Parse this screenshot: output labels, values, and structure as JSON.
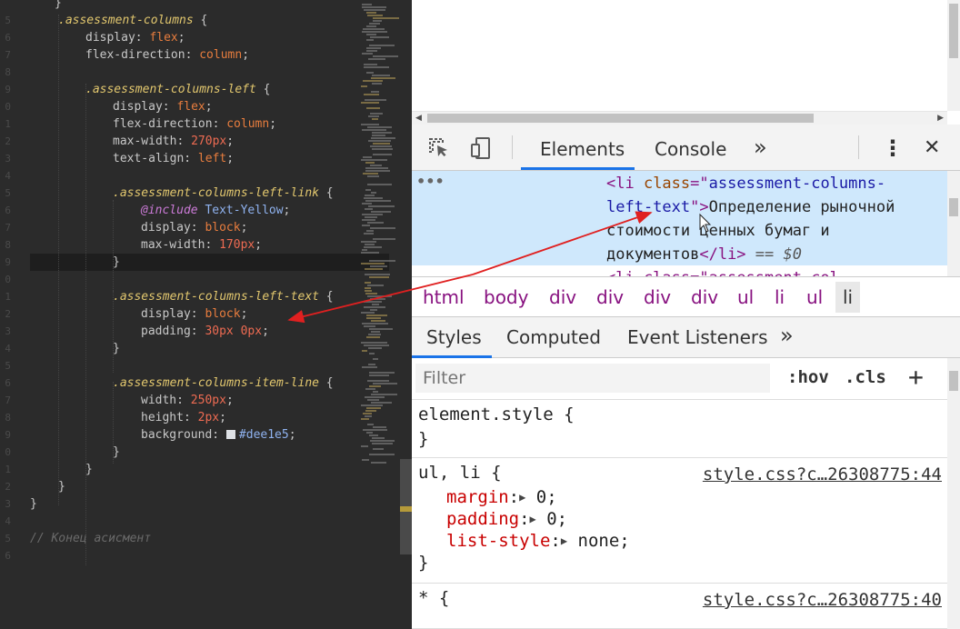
{
  "editor": {
    "lines": [
      {
        "n": "",
        "tokens": [
          {
            "c": "t-prop",
            "t": "}"
          }
        ],
        "indent": 60
      },
      {
        "n": "5",
        "tokens": [
          {
            "c": "t-sel",
            "t": ".assessment-columns"
          },
          {
            "c": "t-prop",
            "t": " {"
          }
        ],
        "indent": 64
      },
      {
        "n": "6",
        "tokens": [
          {
            "c": "t-prop",
            "t": "display: "
          },
          {
            "c": "t-kw",
            "t": "flex"
          },
          {
            "c": "t-prop",
            "t": ";"
          }
        ],
        "indent": 94
      },
      {
        "n": "7",
        "tokens": [
          {
            "c": "t-prop",
            "t": "flex-direction: "
          },
          {
            "c": "t-kw",
            "t": "column"
          },
          {
            "c": "t-prop",
            "t": ";"
          }
        ],
        "indent": 94
      },
      {
        "n": "8",
        "tokens": [],
        "indent": 94
      },
      {
        "n": "9",
        "tokens": [
          {
            "c": "t-sel",
            "t": ".assessment-columns-left"
          },
          {
            "c": "t-prop",
            "t": " {"
          }
        ],
        "indent": 94
      },
      {
        "n": "0",
        "tokens": [
          {
            "c": "t-prop",
            "t": "display: "
          },
          {
            "c": "t-kw",
            "t": "flex"
          },
          {
            "c": "t-prop",
            "t": ";"
          }
        ],
        "indent": 124
      },
      {
        "n": "1",
        "tokens": [
          {
            "c": "t-prop",
            "t": "flex-direction: "
          },
          {
            "c": "t-kw",
            "t": "column"
          },
          {
            "c": "t-prop",
            "t": ";"
          }
        ],
        "indent": 124
      },
      {
        "n": "2",
        "tokens": [
          {
            "c": "t-prop",
            "t": "max-width: "
          },
          {
            "c": "t-num",
            "t": "270px"
          },
          {
            "c": "t-prop",
            "t": ";"
          }
        ],
        "indent": 124
      },
      {
        "n": "3",
        "tokens": [
          {
            "c": "t-prop",
            "t": "text-align: "
          },
          {
            "c": "t-kw",
            "t": "left"
          },
          {
            "c": "t-prop",
            "t": ";"
          }
        ],
        "indent": 124
      },
      {
        "n": "4",
        "tokens": [],
        "indent": 124
      },
      {
        "n": "5",
        "tokens": [
          {
            "c": "t-sel",
            "t": ".assessment-columns-left-link"
          },
          {
            "c": "t-prop",
            "t": " {"
          }
        ],
        "indent": 124
      },
      {
        "n": "6",
        "tokens": [
          {
            "c": "t-at",
            "t": "@include"
          },
          {
            "c": "t-func",
            "t": " Text-Yellow"
          },
          {
            "c": "t-prop",
            "t": ";"
          }
        ],
        "indent": 155
      },
      {
        "n": "7",
        "tokens": [
          {
            "c": "t-prop",
            "t": "display: "
          },
          {
            "c": "t-kw",
            "t": "block"
          },
          {
            "c": "t-prop",
            "t": ";"
          }
        ],
        "indent": 155
      },
      {
        "n": "8",
        "tokens": [
          {
            "c": "t-prop",
            "t": "max-width: "
          },
          {
            "c": "t-num",
            "t": "170px"
          },
          {
            "c": "t-prop",
            "t": ";"
          }
        ],
        "indent": 155
      },
      {
        "n": "9",
        "tokens": [
          {
            "c": "t-prop",
            "t": "}"
          }
        ],
        "indent": 124,
        "active": true
      },
      {
        "n": "0",
        "tokens": [],
        "indent": 124
      },
      {
        "n": "1",
        "tokens": [
          {
            "c": "t-sel",
            "t": ".assessment-columns-left-text"
          },
          {
            "c": "t-prop",
            "t": " {"
          }
        ],
        "indent": 124
      },
      {
        "n": "2",
        "tokens": [
          {
            "c": "t-prop",
            "t": "display: "
          },
          {
            "c": "t-kw",
            "t": "block"
          },
          {
            "c": "t-prop",
            "t": ";"
          }
        ],
        "indent": 155
      },
      {
        "n": "3",
        "tokens": [
          {
            "c": "t-prop",
            "t": "padding: "
          },
          {
            "c": "t-num",
            "t": "30px 0px"
          },
          {
            "c": "t-prop",
            "t": ";"
          }
        ],
        "indent": 155
      },
      {
        "n": "4",
        "tokens": [
          {
            "c": "t-prop",
            "t": "}"
          }
        ],
        "indent": 124
      },
      {
        "n": "5",
        "tokens": [],
        "indent": 124
      },
      {
        "n": "6",
        "tokens": [
          {
            "c": "t-sel",
            "t": ".assessment-columns-item-line"
          },
          {
            "c": "t-prop",
            "t": " {"
          }
        ],
        "indent": 124
      },
      {
        "n": "7",
        "tokens": [
          {
            "c": "t-prop",
            "t": "width: "
          },
          {
            "c": "t-num",
            "t": "250px"
          },
          {
            "c": "t-prop",
            "t": ";"
          }
        ],
        "indent": 155
      },
      {
        "n": "8",
        "tokens": [
          {
            "c": "t-prop",
            "t": "height: "
          },
          {
            "c": "t-num",
            "t": "2px"
          },
          {
            "c": "t-prop",
            "t": ";"
          }
        ],
        "indent": 155
      },
      {
        "n": "9",
        "tokens": [
          {
            "c": "t-prop",
            "t": "background: "
          },
          {
            "c": "swatch",
            "t": ""
          },
          {
            "c": "t-hex",
            "t": "#dee1e5"
          },
          {
            "c": "t-prop",
            "t": ";"
          }
        ],
        "indent": 155
      },
      {
        "n": "0",
        "tokens": [
          {
            "c": "t-prop",
            "t": "}"
          }
        ],
        "indent": 124
      },
      {
        "n": "1",
        "tokens": [
          {
            "c": "t-prop",
            "t": "}"
          }
        ],
        "indent": 94
      },
      {
        "n": "2",
        "tokens": [
          {
            "c": "t-prop",
            "t": "}"
          }
        ],
        "indent": 64
      },
      {
        "n": "3",
        "tokens": [
          {
            "c": "t-prop",
            "t": "}"
          }
        ],
        "indent": 33
      },
      {
        "n": "4",
        "tokens": [],
        "indent": 33
      },
      {
        "n": "5",
        "tokens": [
          {
            "c": "t-com",
            "t": "// Конец асисмент"
          }
        ],
        "indent": 33
      },
      {
        "n": "6",
        "tokens": [],
        "indent": 33
      }
    ]
  },
  "devtools": {
    "toolbar": {
      "tab_elements": "Elements",
      "tab_console": "Console",
      "more": "»",
      "menu": "⋮",
      "close": "✕"
    },
    "elements": {
      "dots": "•••",
      "line1_open": "<li ",
      "line1_attr": "class",
      "line1_eq": "=\"",
      "line1_val": "assessment-columns-",
      "line2_val": "left-text",
      "line2_close": "\">",
      "line2_text": "Определение рыночной",
      "line3_text": "стоимости ценных бумаг и",
      "line4_text": "документов",
      "line4_endtag": "</li>",
      "line4_dollar": " == $0",
      "line5_partial": "<li class=\"assessment-col"
    },
    "breadcrumbs": [
      "html",
      "body",
      "div",
      "div",
      "div",
      "div",
      "ul",
      "li",
      "ul",
      "li"
    ],
    "styles_tabs": {
      "styles": "Styles",
      "computed": "Computed",
      "listeners": "Event Listeners",
      "more": "»"
    },
    "filter": {
      "placeholder": "Filter",
      "hov": ":hov",
      "cls": ".cls",
      "add": "+"
    },
    "rules": [
      {
        "selector": "element.style {",
        "close": "}",
        "source": "",
        "props": []
      },
      {
        "selector": "ul, li {",
        "close": "}",
        "source": "style.css?c…26308775:44",
        "props": [
          {
            "name": "margin",
            "value": "0;"
          },
          {
            "name": "padding",
            "value": "0;"
          },
          {
            "name": "list-style",
            "value": "none;"
          }
        ]
      },
      {
        "selector": "* {",
        "close": "",
        "source": "style.css?c…26308775:40",
        "props": []
      }
    ]
  }
}
